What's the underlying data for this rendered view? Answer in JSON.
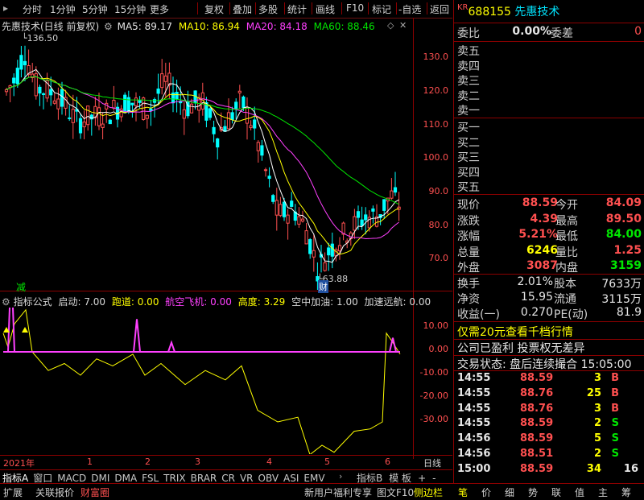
{
  "toolbar": {
    "buttons": [
      "分时",
      "1分钟",
      "5分钟",
      "15分钟",
      "更多",
      "复权",
      "叠加",
      "多股",
      "统计",
      "画线",
      "F10",
      "标记",
      "-自选",
      "返回"
    ]
  },
  "chart": {
    "title": "先惠技术(日线 前复权)",
    "ma5_label": "MA5: 89.17",
    "ma10_label": "MA10: 86.94",
    "ma20_label": "MA20: 84.18",
    "ma60_label": "MA60: 88.46",
    "high_marker": "136.50",
    "low_marker": "63.88",
    "reduce_tag": "减",
    "fin_tag": "财",
    "y_ticks": [
      "130.0",
      "120.0",
      "110.0",
      "100.0",
      "90.0",
      "80.0",
      "70.0"
    ],
    "colors": {
      "ma5": "#ffffff",
      "ma10": "#ffff00",
      "ma20": "#ff40ff",
      "ma60": "#00e600",
      "up": "#ff5050",
      "down": "#00ffff"
    }
  },
  "indicator": {
    "name": "指标公式",
    "items": [
      {
        "label": "启动:",
        "value": "7.00"
      },
      {
        "label": "跑道:",
        "value": "0.00"
      },
      {
        "label": "航空飞机:",
        "value": "0.00"
      },
      {
        "label": "高度:",
        "value": "3.29"
      },
      {
        "label": "空中加油:",
        "value": "1.00"
      },
      {
        "label": "加速远航:",
        "value": "0.00"
      }
    ],
    "y_ticks": [
      "10.00",
      "0.00",
      "-10.00",
      "-20.00",
      "-30.00"
    ]
  },
  "timeline": {
    "year": "2021年",
    "months": [
      "1",
      "2",
      "3",
      "4",
      "5",
      "6"
    ],
    "period": "日线"
  },
  "bottom_tabs": [
    "指标A",
    "窗口",
    "MACD",
    "DMI",
    "DMA",
    "FSL",
    "TRIX",
    "BRAR",
    "CR",
    "VR",
    "OBV",
    "ASI",
    "EMV"
  ],
  "bottom_tabs_right": [
    "指标B",
    "模 板",
    "+",
    "-"
  ],
  "status_bar": {
    "left": [
      "扩展",
      "关联报价",
      "财富圈"
    ],
    "right": [
      "新用户福利专享",
      "图文F10",
      "侧边栏"
    ]
  },
  "quote": {
    "market": "KR",
    "code": "688155",
    "name": "先惠技术",
    "weibi_label": "委比",
    "weibi_value": "0.00%",
    "weicha_label": "委差",
    "weicha_value": "0",
    "sell_levels": [
      "卖五",
      "卖四",
      "卖三",
      "卖二",
      "卖一"
    ],
    "buy_levels": [
      "买一",
      "买二",
      "买三",
      "买四",
      "买五"
    ],
    "stats_left": [
      {
        "label": "现价",
        "value": "88.59"
      },
      {
        "label": "涨跌",
        "value": "4.39"
      },
      {
        "label": "涨幅",
        "value": "5.21%"
      },
      {
        "label": "总量",
        "value": "6246"
      },
      {
        "label": "外盘",
        "value": "3087"
      }
    ],
    "stats_right": [
      {
        "label": "今开",
        "value": "84.09"
      },
      {
        "label": "最高",
        "value": "89.50"
      },
      {
        "label": "最低",
        "value": "84.00"
      },
      {
        "label": "量比",
        "value": "1.25"
      },
      {
        "label": "内盘",
        "value": "3159"
      }
    ],
    "stats2": [
      {
        "l1": "换手",
        "v1": "2.01%",
        "l2": "股本",
        "v2": "7633万"
      },
      {
        "l1": "净资",
        "v1": "15.95",
        "l2": "流通",
        "v2": "3115万"
      },
      {
        "l1": "收益(一)",
        "v1": "0.270",
        "l2": "PE(动)",
        "v2": "81.9"
      }
    ],
    "promo": "仅需20元查看千档行情",
    "profit": "公司已盈利 投票权无差异",
    "trade_status": "交易状态: 盘后连续撮合 15:05:00",
    "ticks": [
      {
        "time": "14:55",
        "price": "88.59",
        "vol": "3",
        "side": "B"
      },
      {
        "time": "14:55",
        "price": "88.76",
        "vol": "25",
        "side": "B"
      },
      {
        "time": "14:55",
        "price": "88.76",
        "vol": "3",
        "side": "B"
      },
      {
        "time": "14:55",
        "price": "88.59",
        "vol": "2",
        "side": "S"
      },
      {
        "time": "14:56",
        "price": "88.59",
        "vol": "5",
        "side": "S"
      },
      {
        "time": "14:56",
        "price": "88.51",
        "vol": "2",
        "side": "S"
      },
      {
        "time": "15:00",
        "price": "88.59",
        "vol": "34",
        "side": "16"
      }
    ],
    "bottom_icons": [
      "笔",
      "价",
      "细",
      "势",
      "联",
      "值",
      "主",
      "筹"
    ]
  }
}
